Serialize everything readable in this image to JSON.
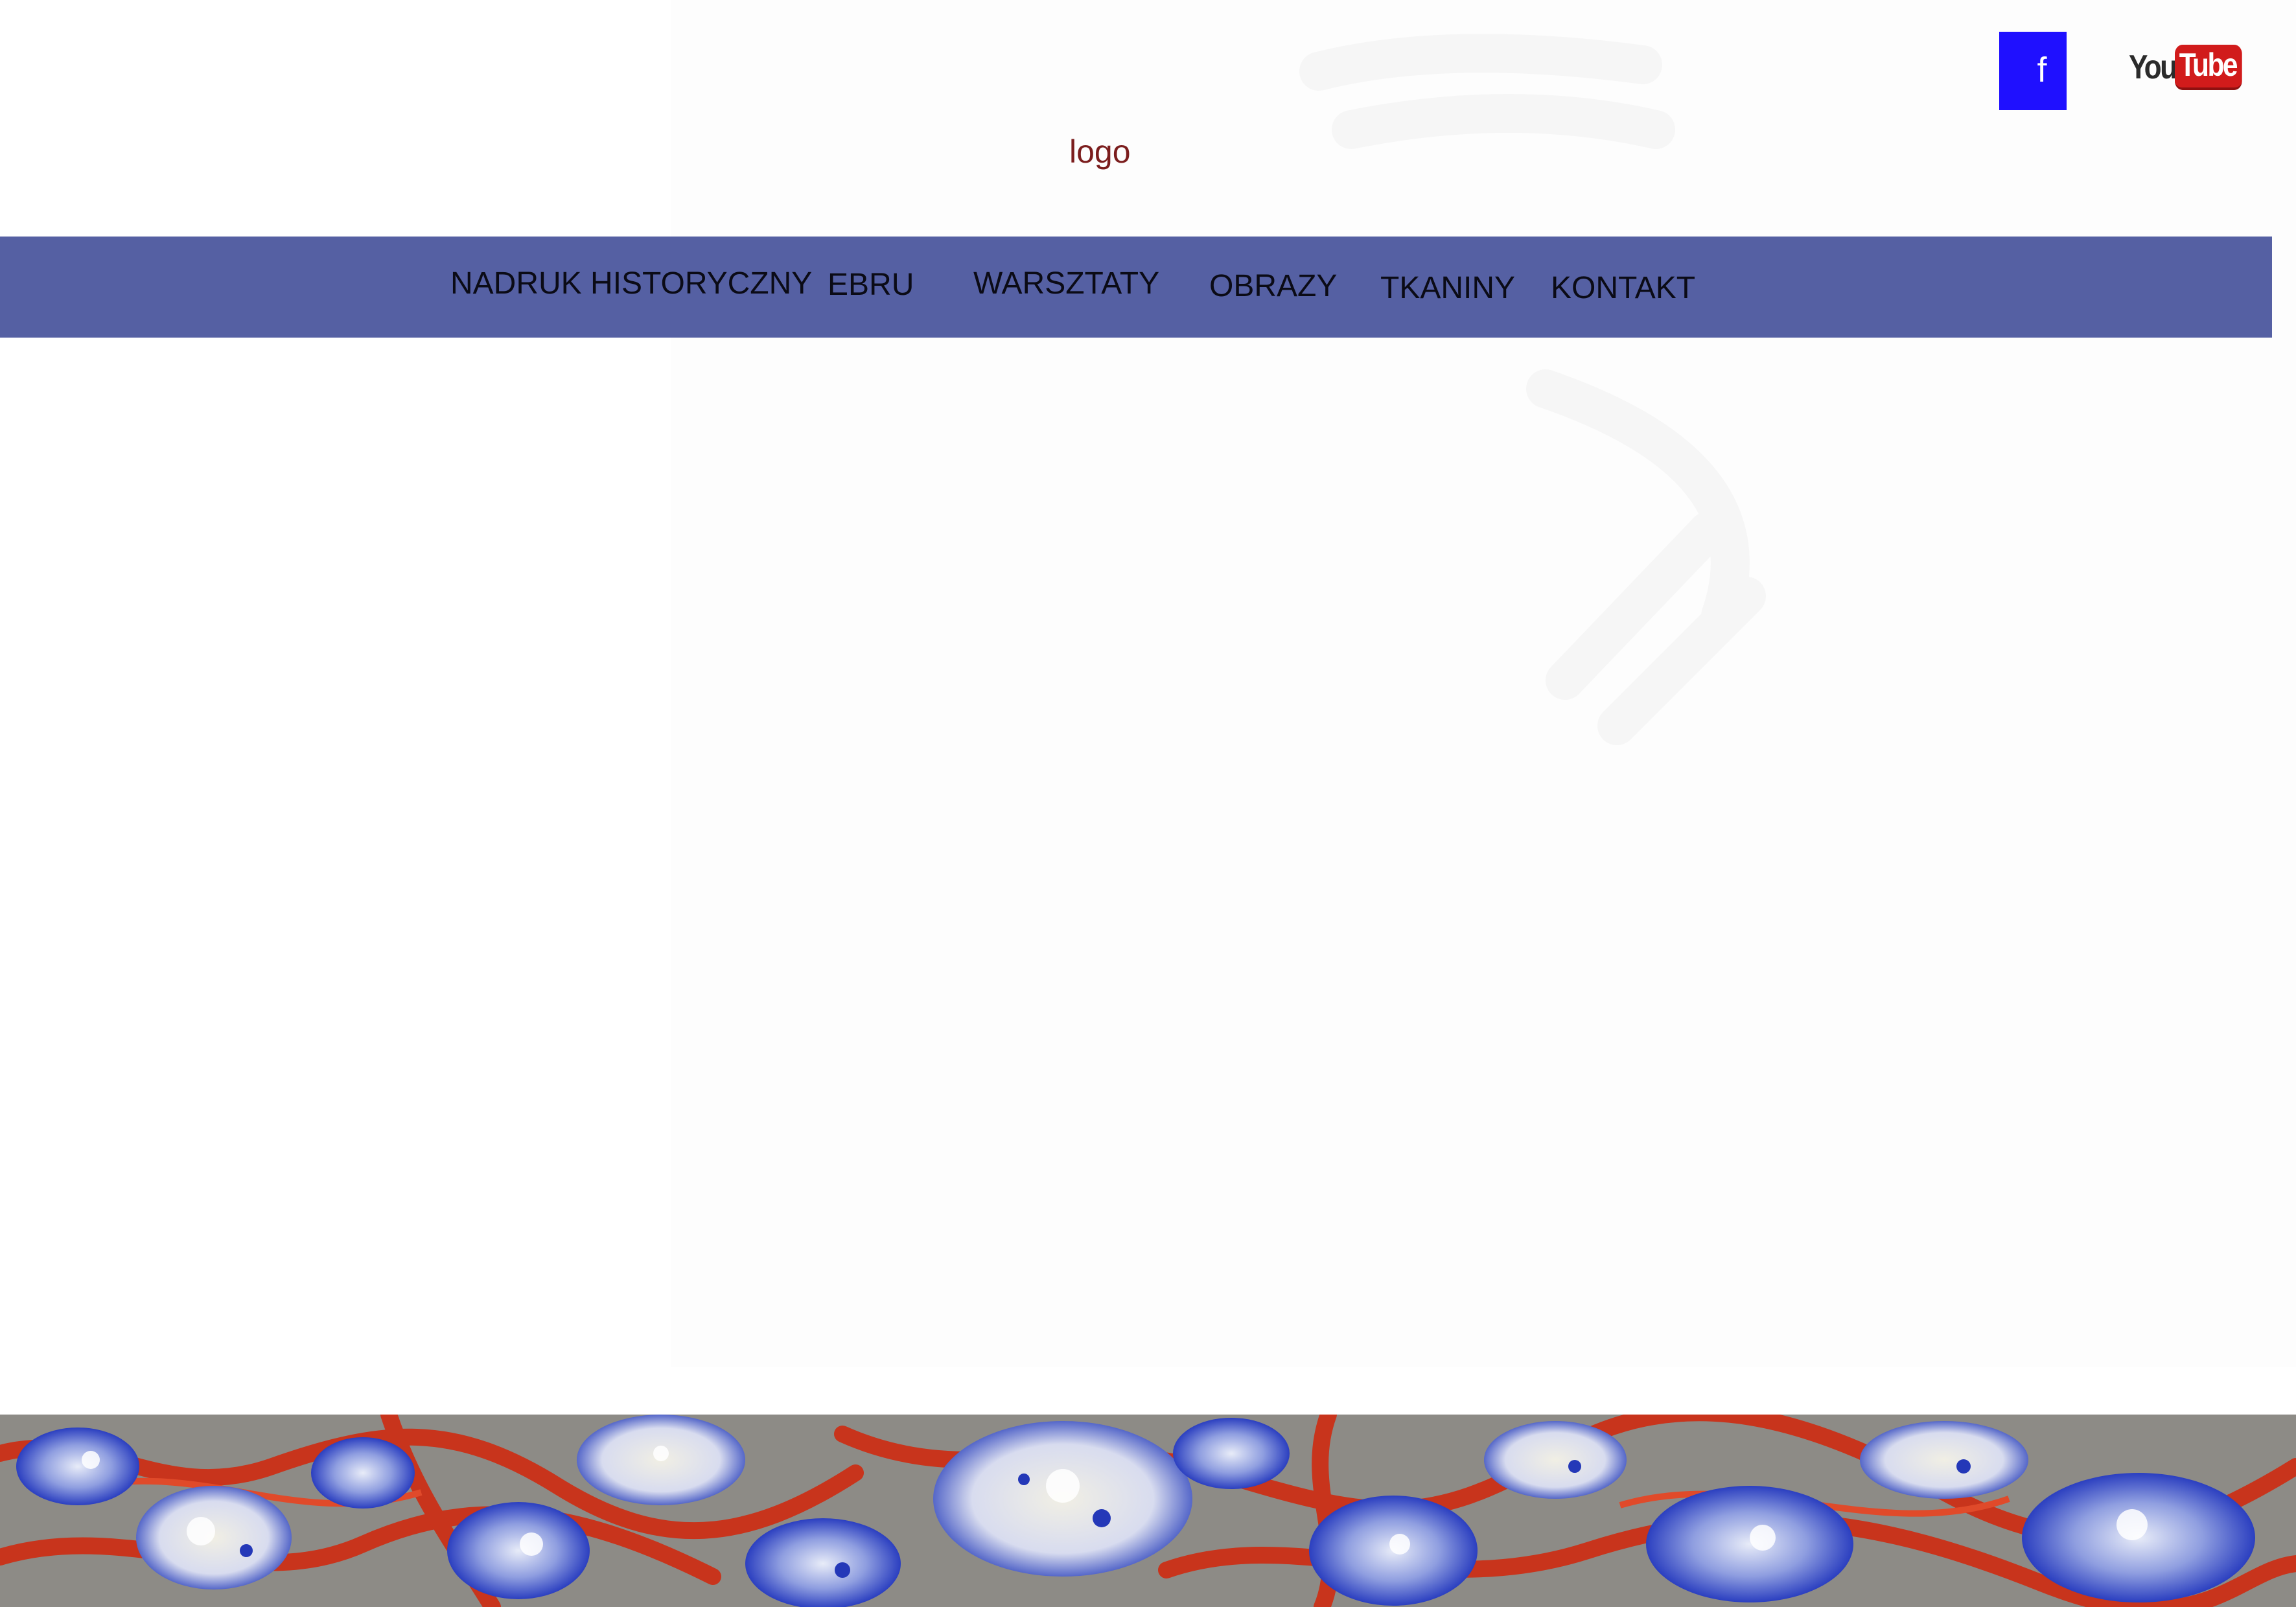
{
  "header": {
    "logo_text": "logo",
    "facebook_label": "f",
    "youtube_you": "You",
    "youtube_tube": "Tube"
  },
  "nav": {
    "items": [
      {
        "label": "NADRUK HISTORYCZNY"
      },
      {
        "label": "EBRU"
      },
      {
        "label": "WARSZTATY"
      },
      {
        "label": "OBRAZY"
      },
      {
        "label": "TKANINY"
      },
      {
        "label": "KONTAKT"
      }
    ]
  },
  "icons": {
    "facebook": "facebook-icon",
    "youtube": "youtube-logo"
  },
  "colors": {
    "nav_bg": "#5560a3",
    "facebook_bg": "#1f10ff",
    "youtube_red": "#d11b1b",
    "logo_text": "#7b1d1d"
  }
}
